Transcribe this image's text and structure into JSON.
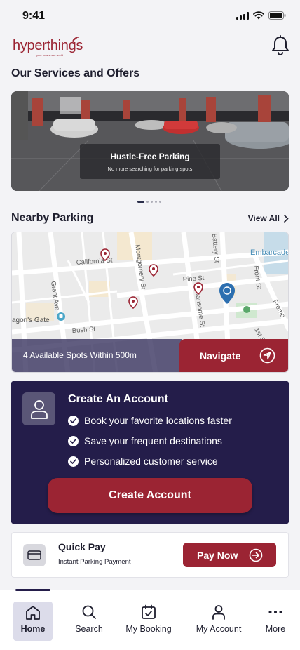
{
  "status_bar": {
    "time": "9:41"
  },
  "header": {
    "logo_text": "hyperthings",
    "logo_tagline": "your new smart world"
  },
  "services": {
    "title": "Our Services and Offers",
    "banner": {
      "title": "Hustle-Free Parking",
      "subtitle": "No more searching for parking spots"
    },
    "carousel_pages": 5,
    "carousel_active_index": 0
  },
  "nearby": {
    "title": "Nearby Parking",
    "view_all": "View All",
    "map_labels": {
      "california": "California St",
      "montgomery": "Montgomery St",
      "battery": "Battery St",
      "embarcadero": "Embarcade",
      "grant": "Grant Ave",
      "pine": "Pine St",
      "front": "Front St",
      "sansome": "Sansome St",
      "gate": "agon's Gate",
      "bush": "Bush St",
      "fremont": "Fremo",
      "first": "1st St"
    },
    "spots_text": "4 Available Spots Within 500m",
    "navigate_label": "Navigate"
  },
  "account": {
    "title": "Create An Account",
    "benefits": [
      "Book your favorite locations faster",
      "Save your frequent destinations",
      "Personalized customer service"
    ],
    "button_label": "Create Account"
  },
  "quick_pay": {
    "title": "Quick Pay",
    "subtitle": "Instant Parking Payment",
    "button_label": "Pay Now"
  },
  "tabs": [
    {
      "label": "Home",
      "icon": "home-icon",
      "active": true
    },
    {
      "label": "Search",
      "icon": "search-icon",
      "active": false
    },
    {
      "label": "My Booking",
      "icon": "calendar-check-icon",
      "active": false
    },
    {
      "label": "My Account",
      "icon": "user-icon",
      "active": false
    },
    {
      "label": "More",
      "icon": "more-dots-icon",
      "active": false
    }
  ],
  "colors": {
    "brand_red": "#9b2433",
    "navy": "#241d4a",
    "background": "#f3f3f6"
  }
}
